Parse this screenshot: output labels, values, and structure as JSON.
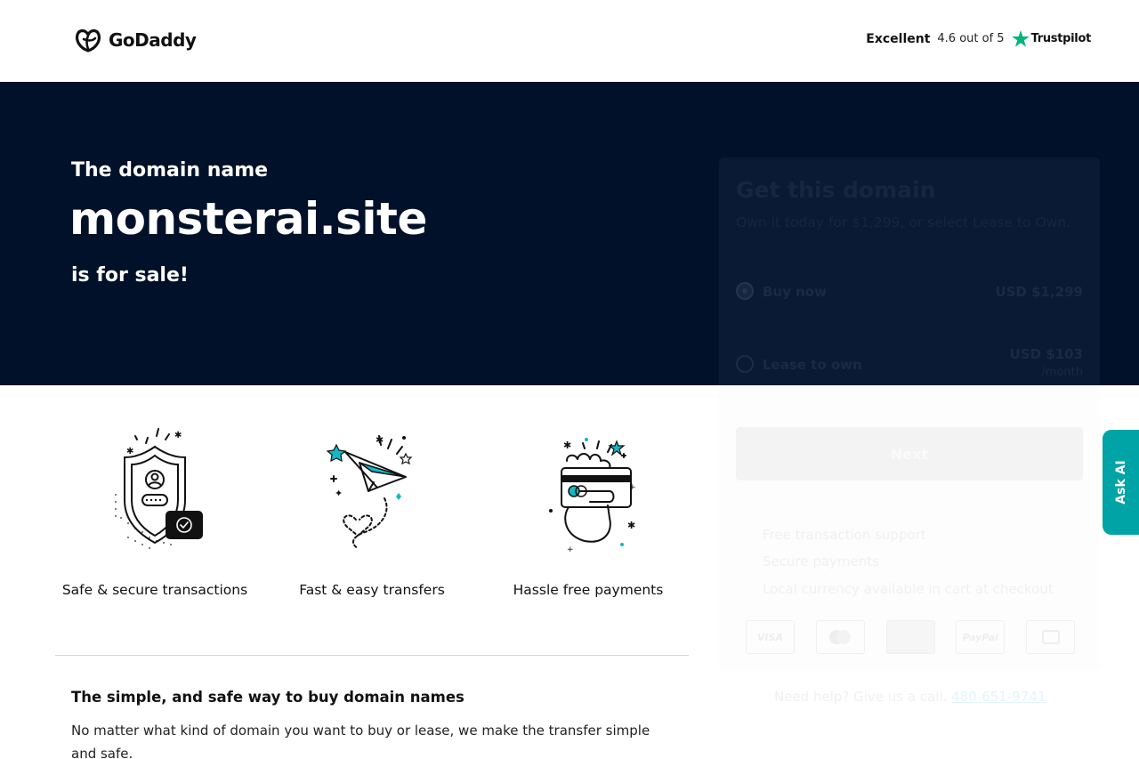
{
  "header": {
    "logo_text": "GoDaddy",
    "rating_word": "Excellent",
    "rating_score": "4.6 out of 5",
    "trustpilot": "Trustpilot"
  },
  "hero": {
    "pre": "The domain name",
    "domain": "monsterai.site",
    "post": "is for sale!"
  },
  "features": [
    {
      "label": "Safe & secure transactions",
      "icon": "shield-icon"
    },
    {
      "label": "Fast & easy transfers",
      "icon": "paper-plane-icon"
    },
    {
      "label": "Hassle free payments",
      "icon": "payment-card-icon"
    }
  ],
  "info": {
    "title": "The simple, and safe way to buy domain names",
    "text": "No matter what kind of domain you want to buy or lease, we make the transfer simple and safe."
  },
  "card": {
    "title": "Get this domain",
    "subtitle": "Own it today for $1,299, or select Lease to Own.",
    "options": [
      {
        "label": "Buy now",
        "price": "USD $1,299",
        "sub": "",
        "selected": true
      },
      {
        "label": "Lease to own",
        "price": "USD $103",
        "sub": "/month",
        "selected": false
      }
    ],
    "next_label": "Next",
    "benefits": [
      "Free transaction support",
      "Secure payments",
      "Local currency available in cart at checkout"
    ],
    "payments": [
      "VISA",
      "",
      "",
      "PayPal",
      ""
    ]
  },
  "help": {
    "text": "Need help? Give us a call.",
    "phone": "480-651-9741"
  },
  "ask_ai": "Ask AI",
  "colors": {
    "hero_bg": "#001129",
    "accent_teal": "#00a4a6",
    "trustpilot_green": "#00b67a"
  }
}
